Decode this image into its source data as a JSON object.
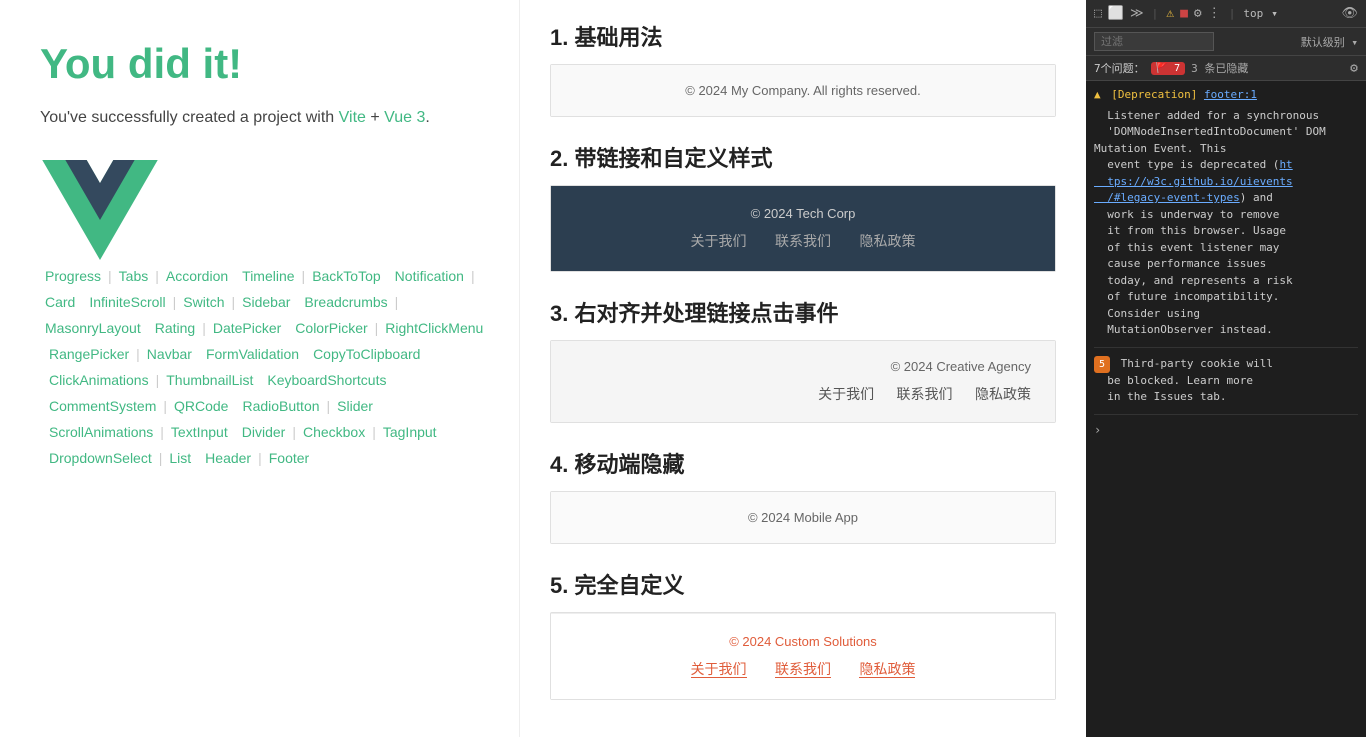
{
  "hero": {
    "title": "You did it!",
    "subtitle_text": "You've successfully created a project with",
    "vite_link": "Vite",
    "plus": "+",
    "vue_link": "Vue 3",
    "period": "."
  },
  "nav": {
    "items": [
      {
        "label": "Progress"
      },
      {
        "label": "Tabs"
      },
      {
        "label": "Accordion"
      },
      {
        "label": "Timeline"
      },
      {
        "label": "BackToTop"
      },
      {
        "label": "Notification"
      },
      {
        "label": "Card"
      },
      {
        "label": "InfiniteScroll"
      },
      {
        "label": "Switch"
      },
      {
        "label": "Sidebar"
      },
      {
        "label": "Breadcrumbs"
      },
      {
        "label": "MasonryLayout"
      },
      {
        "label": "Rating"
      },
      {
        "label": "DatePicker"
      },
      {
        "label": "ColorPicker"
      },
      {
        "label": "RightClickMenu"
      },
      {
        "label": "RangePicker"
      },
      {
        "label": "Navbar"
      },
      {
        "label": "FormValidation"
      },
      {
        "label": "CopyToClipboard"
      },
      {
        "label": "ClickAnimations"
      },
      {
        "label": "ThumbnailList"
      },
      {
        "label": "KeyboardShortcuts"
      },
      {
        "label": "CommentSystem"
      },
      {
        "label": "QRCode"
      },
      {
        "label": "RadioButton"
      },
      {
        "label": "Slider"
      },
      {
        "label": "ScrollAnimations"
      },
      {
        "label": "TextInput"
      },
      {
        "label": "Divider"
      },
      {
        "label": "Checkbox"
      },
      {
        "label": "TagInput"
      },
      {
        "label": "DropdownSelect"
      },
      {
        "label": "List"
      },
      {
        "label": "Header"
      },
      {
        "label": "Footer"
      }
    ]
  },
  "sections": [
    {
      "id": "s1",
      "number": "1.",
      "title": "基础用法",
      "footer_type": "light",
      "copyright": "© 2024 My Company. All rights reserved.",
      "links": []
    },
    {
      "id": "s2",
      "number": "2.",
      "title": "带链接和自定义样式",
      "footer_type": "dark",
      "copyright": "© 2024 Tech Corp",
      "links": [
        "关于我们",
        "联系我们",
        "隐私政策"
      ]
    },
    {
      "id": "s3",
      "number": "3.",
      "title": "右对齐并处理链接点击事件",
      "footer_type": "right",
      "copyright": "© 2024 Creative Agency",
      "links": [
        "关于我们",
        "联系我们",
        "隐私政策"
      ]
    },
    {
      "id": "s4",
      "number": "4.",
      "title": "移动端隐藏",
      "footer_type": "mobile",
      "copyright": "© 2024 Mobile App",
      "links": []
    },
    {
      "id": "s5",
      "number": "5.",
      "title": "完全自定义",
      "footer_type": "custom",
      "copyright": "© 2024 Custom Solutions",
      "links": [
        "关于我们",
        "联系我们",
        "隐私政策"
      ]
    }
  ],
  "devtools": {
    "toolbar_icons": [
      "⬚",
      "⬜",
      "≫",
      "⚠",
      "■",
      "⚙",
      "⋮"
    ],
    "top_label": "top",
    "eye_icon": "👁",
    "filter_placeholder": "过滤",
    "filter_default": "默认级别 ▾",
    "issues_label": "7个问题：",
    "issues_count": "7",
    "hidden_label": "3 条已隐藏",
    "settings_icon": "⚙",
    "log1": {
      "type": "warn",
      "prefix": "[Deprecation]",
      "link_text": "footer:1",
      "body": "Listener added for a synchronous 'DOMNodeInsertedIntoDocument' DOM Mutation Event. This event type is deprecated (ht tps://w3c.github.io/uievents/#legacy-event-types) and work is underway to remove it from this browser. Usage of this event listener may cause performance issues today, and represents a risk of future incompatibility. Consider using MutationObserver instead."
    },
    "log2": {
      "type": "orange",
      "badge": "5",
      "body": "Third-party cookie will be blocked. Learn more in the Issues tab."
    },
    "arrow": "›"
  }
}
